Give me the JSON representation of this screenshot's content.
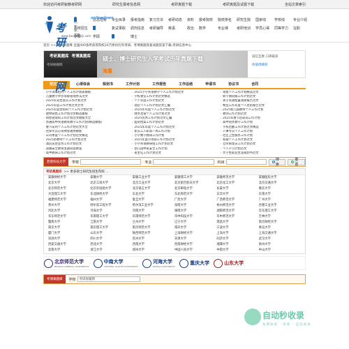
{
  "topbar": {
    "welcome": "欢迎访问考研秘籍考研网",
    "links": [
      "研究生报考信息网",
      "考研真题下载",
      "考研真题及试题下载",
      "全站文章索引"
    ]
  },
  "logo": {
    "name": "考研秘籍网",
    "en": "onlinedown",
    "small": "考研，考课，考编",
    "url": "www.kaoyanmiji.com"
  },
  "nav": [
    "信息招考",
    "专业目录",
    "报考指南",
    "复习方法",
    "考研动态",
    "资料",
    "报考院校",
    "院校排名",
    "研究生院",
    "国家线",
    "学校线",
    "专业介绍",
    "高校招生",
    "复试录取",
    "调剂信息",
    "考研辅导",
    "英语",
    "政治",
    "数学",
    "专业课",
    "考研培训",
    "学员心得",
    "同等学力",
    "在职",
    "专硕",
    "学硕",
    "博士"
  ],
  "breadcrumb": "首页 >> 考研试题库 全国400多所高等院校20万余份历年考研、考博真题及复试题答案下载,考研信息中心",
  "banner": {
    "left_title": "考研真题库",
    "left_title2": "考博真题库",
    "left_sub": "考研秘籍网",
    "mid_title": "硕士、博士研究生入学考试历年真题下载",
    "mid_sub": "海量",
    "right_1": "诚信互惠 口碑载道",
    "right_2": "你值得拥有"
  },
  "tabs": [
    "范文文档",
    "心得体会",
    "规划书",
    "工作计划",
    "工作报告",
    "工作总结",
    "申请书",
    "协议书",
    "合同"
  ],
  "articles": {
    "col1": [
      "小学消毒柜的个人工作计划表模板",
      "儿童教学评价等级管理办法范文",
      "2025年双生会员工作计划范文",
      "2025年度工作计划范文范文",
      "2025年度营销的个人工作计划范文",
      "建材销售工作计划范文精选模板",
      "销售管理的工作计划范文模板大全",
      "普通高中英语教育教学工作计划(精选模板)",
      "春节前的个人工作计划范文大全",
      "社保专员心得体会通用模板",
      "公司季度个人工作计划范文精选",
      "2025新教师个人工作计划范文",
      "酒店前台业务工作计划范文",
      "道路安全教育主题班会教案",
      "高中教研工作计划范文"
    ],
    "col2": [
      "2025小学英语教学个人工作计划范文",
      "学校食堂工作计划范文精选",
      "个人年度工作计划范文",
      "酒店个人工作计划范文汇编",
      "2025年年度个人工作计划范文",
      "财务主管个人工作计划范文",
      "2025优秀工作计划范文汇编",
      "医院档案工作计划范文",
      "2025年年度个人工作计划范文",
      "新员工入职第一周工作计划",
      "小学数学教研工作计划",
      "2025年度市场部工作计划范文",
      "小学英语教研组工作计划范文",
      "幼儿园中班安全工作计划",
      "班主任工作计划范文"
    ],
    "col3": [
      "销售个人工作计划精选范文",
      "新学期班级工作计划范文",
      "关于资源配置调查报告范文",
      "物业工作年度个人总结报告范文",
      "2025幼儿园教师个人工作计划",
      "教师工作计划范文",
      "2025年春节后返岗工作计划",
      "高中语文教学工作计划",
      "学校后勤工作计划范文精选",
      "人事专员个人工作计划",
      "社区卫生服务工作计划",
      "客服个人工作计划范文",
      "仓库管理员工作计划范文",
      "个人学习计划范文",
      "大学生职业生涯规划书范文"
    ]
  },
  "search1": {
    "tab": "西南科技大学",
    "school_label": "学校",
    "major_label": "专业",
    "subject_label": "科目",
    "search_btn": "搜索",
    "reset_btn": "重置"
  },
  "school_section": {
    "head_red": "考研真题库",
    "head": ">> 更多硕士研究生招生院校 ...",
    "schools": [
      "安徽财经大学",
      "安徽大学",
      "安徽工业大学",
      "安徽理工大学",
      "安徽师范大学",
      "安徽医科大学",
      "北京大学",
      "北京工商大学",
      "北京工业大学",
      "北京航空航天大学",
      "北京化工大学",
      "北京交通大学",
      "北京师范大学",
      "北京外国语大学",
      "北京语言大学",
      "北京邮电大学",
      "长安大学",
      "重庆大学",
      "大连理工大学",
      "东北财经大学",
      "东北大学",
      "东北师范大学",
      "东华大学",
      "东南大学",
      "福建师范大学",
      "福州大学",
      "复旦大学",
      "广西大学",
      "广西师范大学",
      "广州大学",
      "贵州大学",
      "哈尔滨工程大学",
      "哈尔滨工业大学",
      "海南大学",
      "杭州师范大学",
      "合肥工业大学",
      "河北大学",
      "河海大学",
      "河南大学",
      "湖南大学",
      "湖南师范大学",
      "华东理工大学",
      "华东师范大学",
      "华南理工大学",
      "华南师范大学",
      "华中科技大学",
      "华中师范大学",
      "吉林大学",
      "暨南大学",
      "江南大学",
      "兰州大学",
      "辽宁大学",
      "南昌大学",
      "南京财经大学",
      "南京大学",
      "南京理工大学",
      "南京师范大学",
      "南开大学",
      "宁波大学",
      "青岛大学",
      "厦门大学",
      "山东大学",
      "陕西师范大学",
      "上海财经大学",
      "上海大学",
      "上海交通大学",
      "深圳大学",
      "四川大学",
      "苏州大学",
      "天津大学",
      "同济大学",
      "武汉大学",
      "西安交通大学",
      "西北大学",
      "西南大学",
      "西南财经大学",
      "湘潭大学",
      "扬州大学",
      "云南大学",
      "浙江大学",
      "郑州大学",
      "中国人民大学",
      "中南大学",
      "中山大学"
    ]
  },
  "uni_logos": [
    {
      "name": "北京师范大学",
      "sub": "BEIJING NORMAL UNIVERSITY",
      "color": "purple"
    },
    {
      "name": "中南大学",
      "sub": "CENTRAL SOUTH UNIVERSITY",
      "color": "blue"
    },
    {
      "name": "河海大学",
      "sub": "HOHAI UNIVERSITY",
      "color": "blue"
    },
    {
      "name": "重庆大学",
      "sub": "",
      "color": "blue"
    },
    {
      "name": "山东大学",
      "sub": "",
      "color": "red"
    }
  ],
  "watermark": {
    "text": "自动秒收录",
    "sub": "免费收录 · 效果 · 自动收录"
  },
  "search2": {
    "tab": "考博真题库",
    "school_label": "学校",
    "school_value": "考研秘籍网"
  }
}
